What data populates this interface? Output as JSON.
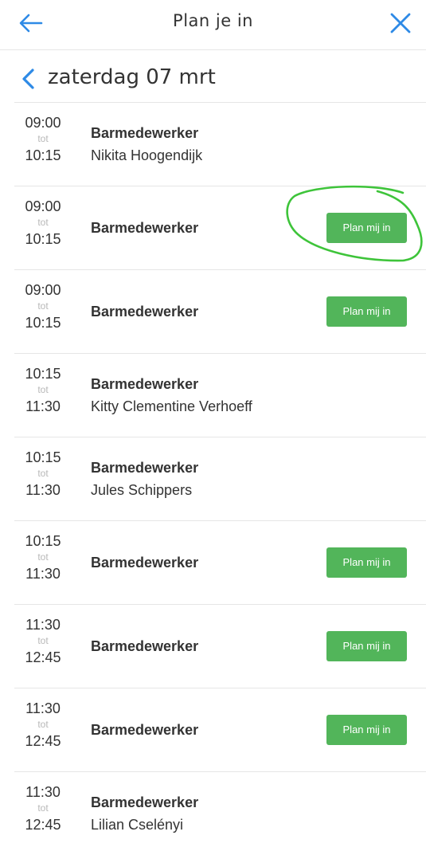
{
  "header": {
    "title": "Plan je in",
    "back_icon": "arrow-left-icon",
    "close_icon": "close-x-icon",
    "accent_color": "#2e8ae6"
  },
  "date_nav": {
    "date_label": "zaterdag 07 mrt",
    "prev_icon": "chevron-left-icon"
  },
  "button_color": "#52b55a",
  "annotation_color": "#3ec43a",
  "shifts": [
    {
      "start": "09:00",
      "sep": "tot",
      "end": "10:15",
      "role": "Barmedewerker",
      "person": "Nikita Hoogendijk",
      "button": ""
    },
    {
      "start": "09:00",
      "sep": "tot",
      "end": "10:15",
      "role": "Barmedewerker",
      "person": "",
      "button": "Plan mij in"
    },
    {
      "start": "09:00",
      "sep": "tot",
      "end": "10:15",
      "role": "Barmedewerker",
      "person": "",
      "button": "Plan mij in"
    },
    {
      "start": "10:15",
      "sep": "tot",
      "end": "11:30",
      "role": "Barmedewerker",
      "person": "Kitty Clementine Verhoeff",
      "button": ""
    },
    {
      "start": "10:15",
      "sep": "tot",
      "end": "11:30",
      "role": "Barmedewerker",
      "person": "Jules Schippers",
      "button": ""
    },
    {
      "start": "10:15",
      "sep": "tot",
      "end": "11:30",
      "role": "Barmedewerker",
      "person": "",
      "button": "Plan mij in"
    },
    {
      "start": "11:30",
      "sep": "tot",
      "end": "12:45",
      "role": "Barmedewerker",
      "person": "",
      "button": "Plan mij in"
    },
    {
      "start": "11:30",
      "sep": "tot",
      "end": "12:45",
      "role": "Barmedewerker",
      "person": "",
      "button": "Plan mij in"
    },
    {
      "start": "11:30",
      "sep": "tot",
      "end": "12:45",
      "role": "Barmedewerker",
      "person": "Lilian Cselényi",
      "button": ""
    }
  ]
}
